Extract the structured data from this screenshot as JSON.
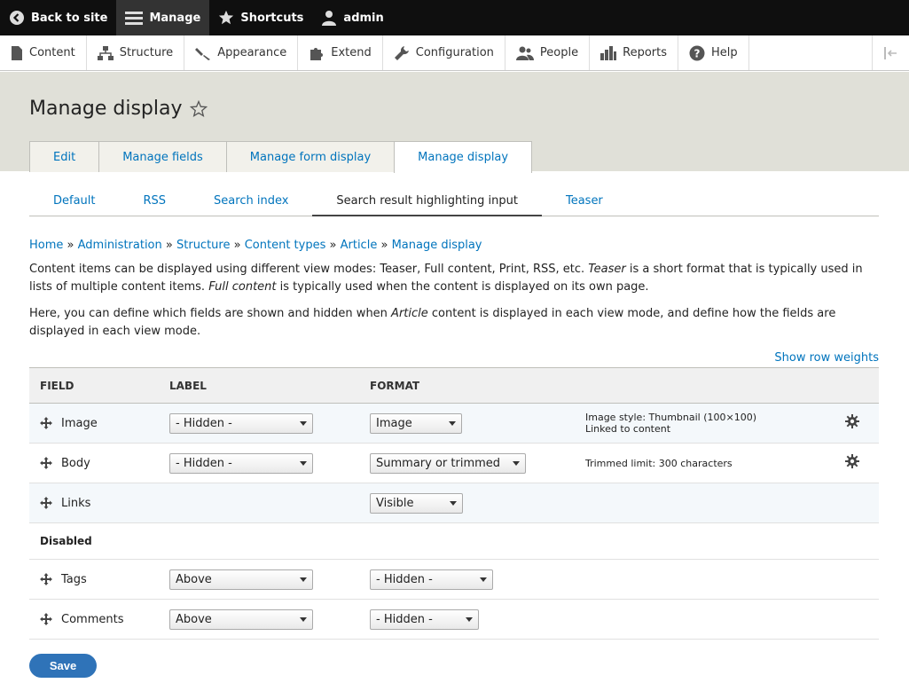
{
  "toolbar": {
    "back": "Back to site",
    "manage": "Manage",
    "shortcuts": "Shortcuts",
    "user": "admin"
  },
  "tray": {
    "items": [
      {
        "label": "Content",
        "icon": "content-icon"
      },
      {
        "label": "Structure",
        "icon": "structure-icon"
      },
      {
        "label": "Appearance",
        "icon": "appearance-icon"
      },
      {
        "label": "Extend",
        "icon": "extend-icon"
      },
      {
        "label": "Configuration",
        "icon": "configuration-icon"
      },
      {
        "label": "People",
        "icon": "people-icon"
      },
      {
        "label": "Reports",
        "icon": "reports-icon"
      },
      {
        "label": "Help",
        "icon": "help-icon"
      }
    ]
  },
  "page": {
    "title": "Manage display"
  },
  "tabs": [
    "Edit",
    "Manage fields",
    "Manage form display",
    "Manage display"
  ],
  "subtabs": [
    "Default",
    "RSS",
    "Search index",
    "Search result highlighting input",
    "Teaser"
  ],
  "breadcrumb": {
    "items": [
      "Home",
      "Administration",
      "Structure",
      "Content types",
      "Article",
      "Manage display"
    ],
    "separator": "»"
  },
  "description": {
    "p1_a": "Content items can be displayed using different view modes: Teaser, Full content, Print, RSS, etc. ",
    "p1_em1": "Teaser",
    "p1_b": " is a short format that is typically used in lists of multiple content items. ",
    "p1_em2": "Full content",
    "p1_c": " is typically used when the content is displayed on its own page.",
    "p2_a": "Here, you can define which fields are shown and hidden when ",
    "p2_em": "Article",
    "p2_b": " content is displayed in each view mode, and define how the fields are displayed in each view mode."
  },
  "show_weights": "Show row weights",
  "table": {
    "headers": {
      "field": "FIELD",
      "label": "LABEL",
      "format": "FORMAT"
    },
    "rows": [
      {
        "field": "Image",
        "label": "- Hidden -",
        "format": "Image",
        "summary1": "Image style: Thumbnail (100×100)",
        "summary2": "Linked to content"
      },
      {
        "field": "Body",
        "label": "- Hidden -",
        "format": "Summary or trimmed",
        "summary1": "Trimmed limit: 300 characters"
      },
      {
        "field": "Links",
        "format": "Visible"
      }
    ],
    "disabled_label": "Disabled",
    "disabled_rows": [
      {
        "field": "Tags",
        "label": "Above",
        "format": "- Hidden -"
      },
      {
        "field": "Comments",
        "label": "Above",
        "format": "- Hidden -"
      }
    ]
  },
  "save_label": "Save",
  "colors": {
    "link": "#0074bd",
    "save": "#2f73b8",
    "toolbar": "#0f0f0f"
  }
}
